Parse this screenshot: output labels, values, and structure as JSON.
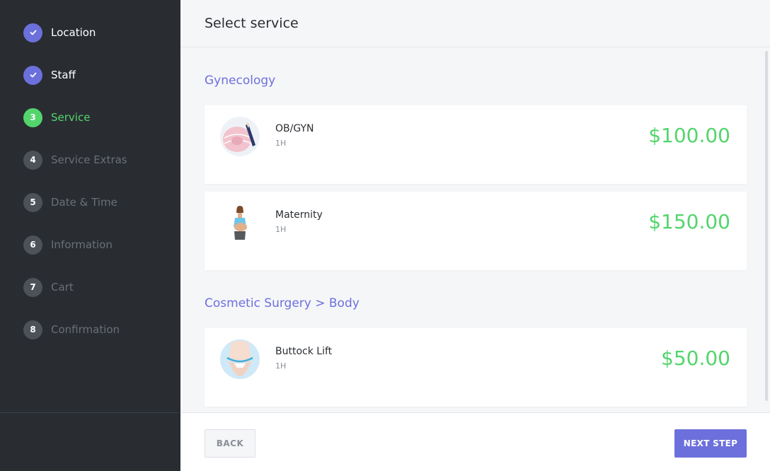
{
  "sidebar": {
    "steps": [
      {
        "number": "1",
        "label": "Location",
        "state": "done"
      },
      {
        "number": "2",
        "label": "Staff",
        "state": "done"
      },
      {
        "number": "3",
        "label": "Service",
        "state": "active"
      },
      {
        "number": "4",
        "label": "Service Extras",
        "state": "pending"
      },
      {
        "number": "5",
        "label": "Date & Time",
        "state": "pending"
      },
      {
        "number": "6",
        "label": "Information",
        "state": "pending"
      },
      {
        "number": "7",
        "label": "Cart",
        "state": "pending"
      },
      {
        "number": "8",
        "label": "Confirmation",
        "state": "pending"
      }
    ]
  },
  "header": {
    "title": "Select service"
  },
  "categories": [
    {
      "name": "Gynecology",
      "services": [
        {
          "name": "OB/GYN",
          "duration": "1H",
          "price": "$100.00",
          "image": "pregnant-belly-photo"
        },
        {
          "name": "Maternity",
          "duration": "1H",
          "price": "$150.00",
          "image": "maternity-woman-photo"
        }
      ]
    },
    {
      "name": "Cosmetic Surgery > Body",
      "services": [
        {
          "name": "Buttock Lift",
          "duration": "1H",
          "price": "$50.00",
          "image": "body-measure-photo"
        }
      ]
    }
  ],
  "footer": {
    "back_label": "BACK",
    "next_label": "NEXT STEP"
  },
  "colors": {
    "accent": "#6c70dc",
    "success": "#53d56c",
    "sidebar_bg": "#292d32",
    "content_bg": "#f5f6f8"
  }
}
